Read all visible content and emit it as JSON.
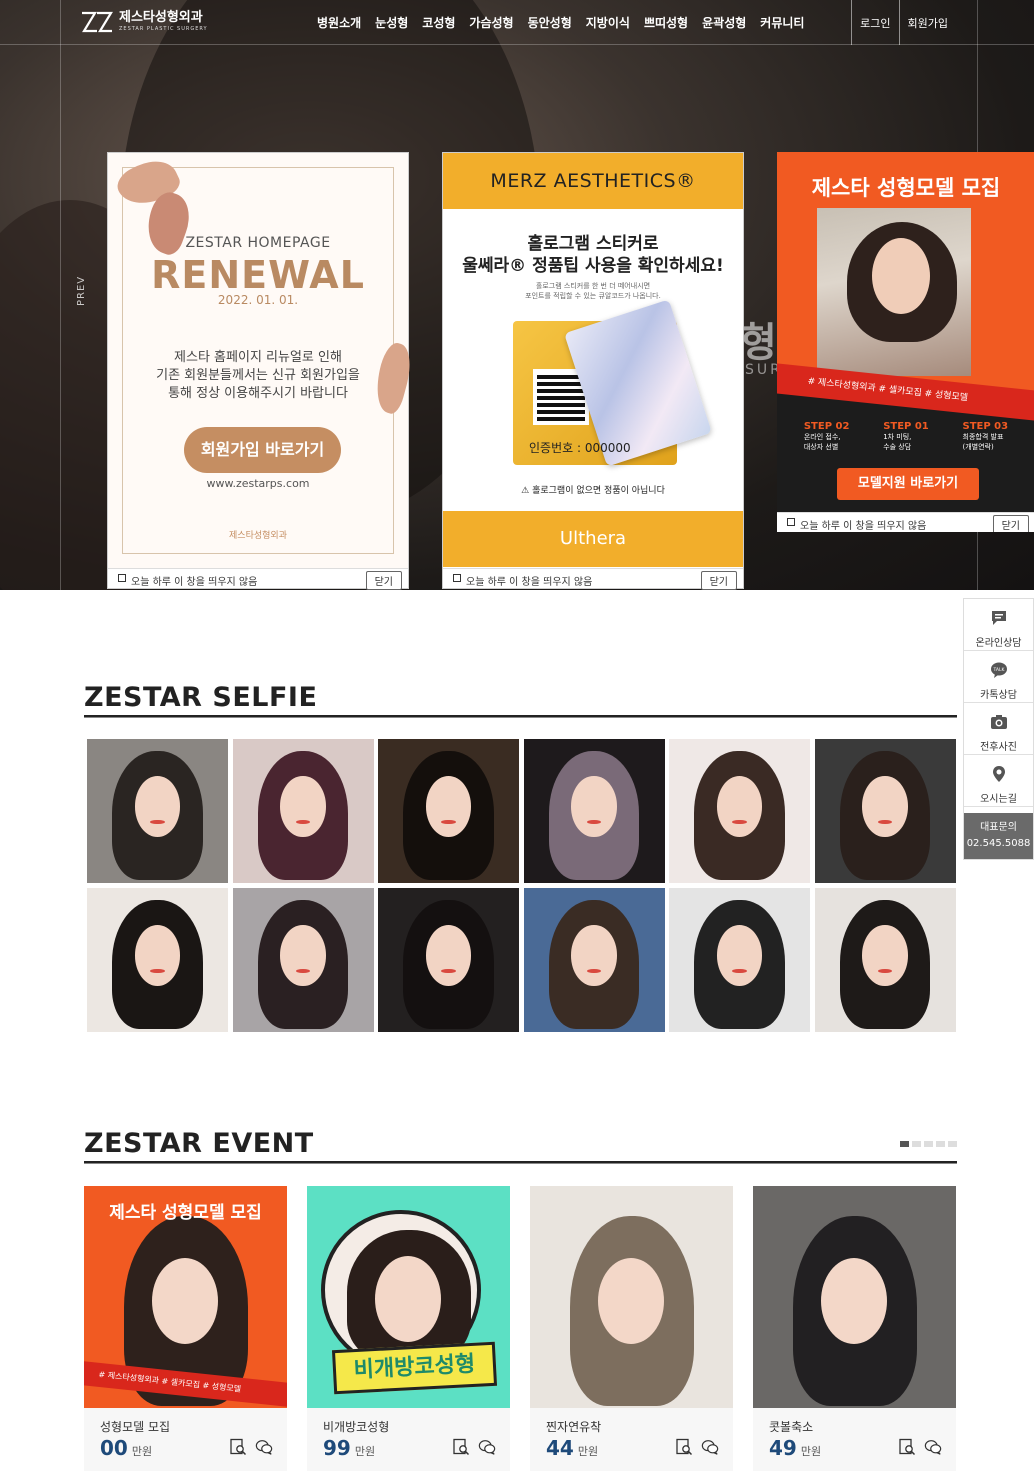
{
  "header": {
    "logo_main": "제스타성형외과",
    "logo_sub": "ZESTAR PLASTIC SURGERY",
    "nav": [
      "병원소개",
      "눈성형",
      "코성형",
      "가슴성형",
      "동안성형",
      "지방이식",
      "쁘띠성형",
      "윤곽성형",
      "커뮤니티"
    ],
    "login": "로그인",
    "signup": "회원가입"
  },
  "hero": {
    "prev_label": "PREV",
    "ghost_text": "형외",
    "ghost_sub": "SUR"
  },
  "popup1": {
    "line1": "ZESTAR HOMEPAGE",
    "line2": "RENEWAL",
    "date": "2022. 01. 01.",
    "body1": "제스타 홈페이지 리뉴얼로 인해",
    "body2": "기존 회원분들께서는 신규 회원가입을",
    "body3": "통해 정상 이용해주시기 바랍니다",
    "button": "회원가입 바로가기",
    "url": "www.zestarps.com",
    "brand": "제스타성형외과",
    "footer_label": "오늘 하루 이 창을 띄우지 않음",
    "close": "닫기"
  },
  "popup2": {
    "brand": "MERZ AESTHETICS®",
    "head1": "홀로그램 스티커로",
    "head2": "울쎄라® 정품팁 사용을 확인하세요!",
    "sub1": "홀로그램 스티커를 한 번 더 떼어내시면",
    "sub2": "포인트를 적립할 수 있는 큐알코드가 나옵니다.",
    "code": "인증번호 : 000000",
    "warning": "홀로그램이 없으면 정품이 아닙니다",
    "bottom_brand": "Ulthera",
    "footer_label": "오늘 하루 이 창을 띄우지 않음",
    "close": "닫기"
  },
  "popup3": {
    "title": "제스타 성형모델 모집",
    "tags": "# 제스타성형외과  # 셀카모집  # 성형모델",
    "steps": [
      {
        "step": "STEP 02",
        "text1": "온라인 접수,",
        "text2": "대상자 선별"
      },
      {
        "step": "STEP 01",
        "text1": "1차 미팅,",
        "text2": "수술 상담"
      },
      {
        "step": "STEP 03",
        "text1": "최종합격 발표",
        "text2": "(개별연락)"
      }
    ],
    "button": "모델지원 바로가기",
    "footer_label": "오늘 하루 이 창을 띄우지 않음",
    "close": "닫기"
  },
  "quick_menu": {
    "items": [
      "온라인상담",
      "카톡상담",
      "전후사진",
      "오시는길"
    ],
    "phone_label": "대표문의",
    "phone": "02.545.5088"
  },
  "selfie": {
    "title": "ZESTAR SELFIE",
    "photos": [
      {
        "bg": "#8a8682",
        "hair": "#2a2522"
      },
      {
        "bg": "#d9c9c6",
        "hair": "#4a2530"
      },
      {
        "bg": "#3a2c22",
        "hair": "#140f0c"
      },
      {
        "bg": "#1e1a1c",
        "hair": "#7a6a78"
      },
      {
        "bg": "#efe8e6",
        "hair": "#3a2a24"
      },
      {
        "bg": "#3a3a3a",
        "hair": "#2a201c"
      },
      {
        "bg": "#ece7e2",
        "hair": "#1a1614"
      },
      {
        "bg": "#a8a4a6",
        "hair": "#2a2022"
      },
      {
        "bg": "#232020",
        "hair": "#141010"
      },
      {
        "bg": "#4a6a96",
        "hair": "#3a2c24"
      },
      {
        "bg": "#e4e4e4",
        "hair": "#222222"
      },
      {
        "bg": "#e6e2de",
        "hair": "#1e1a18"
      }
    ]
  },
  "event": {
    "title": "ZESTAR EVENT",
    "items": [
      {
        "name": "성형모델 모집",
        "price": "00",
        "unit": "만원",
        "bg": "#f15a22",
        "hair": "#2e211c",
        "banner": "제스타 성형모델 모집",
        "tags": "# 제스타성형외과  # 셀카모집  # 성형모델"
      },
      {
        "name": "비개방코성형",
        "price": "99",
        "unit": "만원",
        "bg": "#5ce0c4",
        "hair": "#2a1e1a",
        "banner": "비개방코성형"
      },
      {
        "name": "찐자연유착",
        "price": "44",
        "unit": "만원",
        "bg": "#e9e4de",
        "hair": "#7d6e5e"
      },
      {
        "name": "콧볼축소",
        "price": "49",
        "unit": "만원",
        "bg": "#6a6866",
        "hair": "#222022"
      }
    ]
  }
}
